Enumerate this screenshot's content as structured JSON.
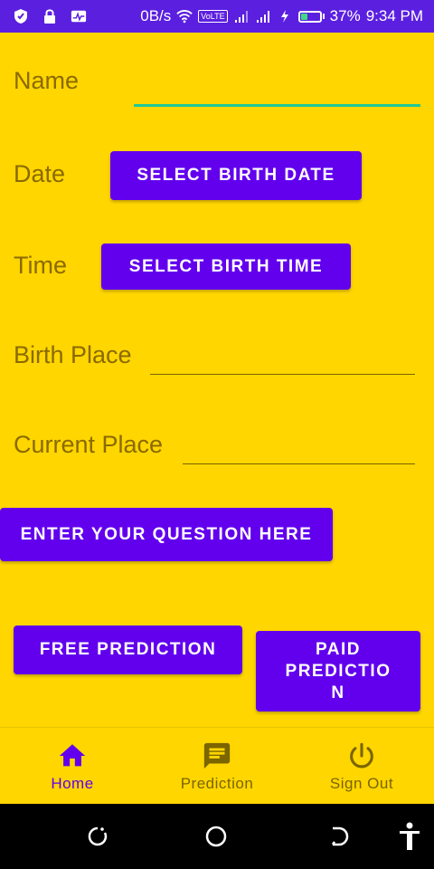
{
  "status_bar": {
    "data_speed": "0B/s",
    "volte_label": "VoLTE",
    "battery_percent": "37%",
    "battery_level": 0.37,
    "time": "9:34 PM",
    "icons": [
      "shield-icon",
      "lock-icon",
      "activity-icon",
      "wifi-icon",
      "signal-icon",
      "signal-icon",
      "charging-icon",
      "battery-icon"
    ]
  },
  "form": {
    "name_label": "Name",
    "name_value": "",
    "date_label": "Date",
    "date_button": "SELECT BIRTH DATE",
    "time_label": "Time",
    "time_button": "SELECT BIRTH TIME",
    "birth_place_label": "Birth Place",
    "birth_place_value": "",
    "current_place_label": "Current Place",
    "current_place_value": "",
    "question_button": "ENTER YOUR QUESTION HERE",
    "free_prediction_button": "FREE PREDICTION",
    "paid_prediction_line1": "PAID",
    "paid_prediction_line2": "PREDICTIO",
    "paid_prediction_line3": "N"
  },
  "bottom_nav": {
    "items": [
      {
        "label": "Home",
        "icon": "home-icon",
        "active": true
      },
      {
        "label": "Prediction",
        "icon": "message-icon",
        "active": false
      },
      {
        "label": "Sign Out",
        "icon": "power-icon",
        "active": false
      }
    ]
  },
  "system_nav": {
    "icons": [
      "recents-icon",
      "home-circle-icon",
      "back-icon",
      "accessibility-icon"
    ]
  },
  "colors": {
    "background": "#FFD600",
    "status_bar": "#5B1FE0",
    "primary": "#6200EE",
    "label": "#8A6A00",
    "focus_underline": "#20C997"
  }
}
